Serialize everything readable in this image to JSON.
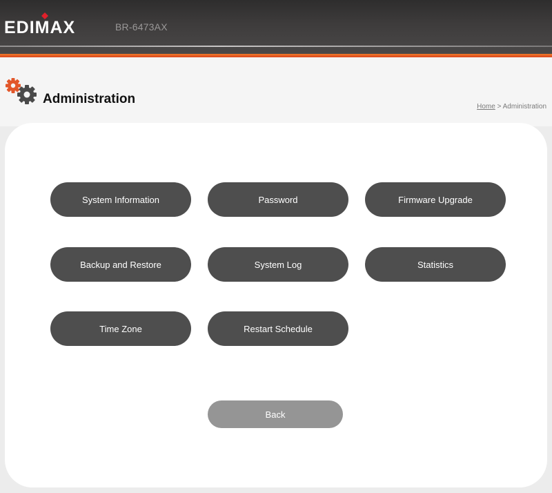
{
  "header": {
    "brand": "EDIMAX",
    "model": "BR-6473AX"
  },
  "page": {
    "title": "Administration",
    "icon": "gears-icon"
  },
  "breadcrumb": {
    "home": "Home",
    "separator": ">",
    "current": "Administration"
  },
  "menu": [
    {
      "label": "System Information"
    },
    {
      "label": "Password"
    },
    {
      "label": "Firmware Upgrade"
    },
    {
      "label": "Backup and Restore"
    },
    {
      "label": "System Log"
    },
    {
      "label": "Statistics"
    },
    {
      "label": "Time Zone"
    },
    {
      "label": "Restart Schedule"
    }
  ],
  "back_label": "Back",
  "colors": {
    "accent": "#e2572a",
    "button": "#4e4e4e",
    "back_button": "#959595",
    "header": "#3a3838"
  }
}
